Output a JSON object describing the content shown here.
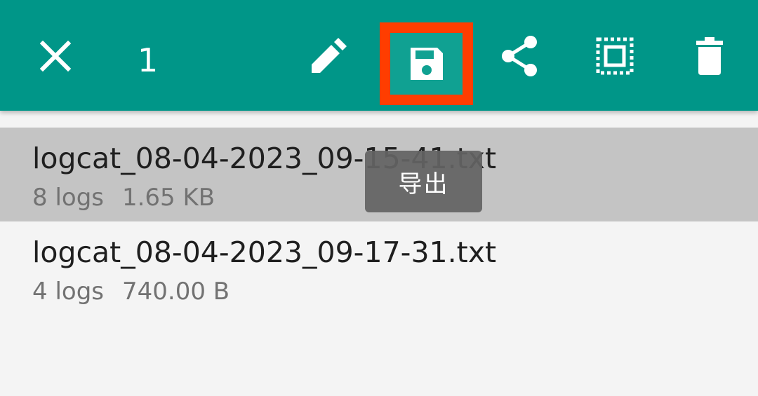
{
  "toolbar": {
    "selected_count": "1",
    "icons": [
      "close-icon",
      "pencil-icon",
      "save-icon",
      "share-icon",
      "select-all-icon",
      "delete-icon"
    ],
    "background": "#009688",
    "highlight_color": "#ff3d00"
  },
  "files": [
    {
      "name": "logcat_08-04-2023_09-15-41.txt",
      "logs": "8 logs",
      "size": "1.65 KB",
      "selected": true
    },
    {
      "name": "logcat_08-04-2023_09-17-31.txt",
      "logs": "4 logs",
      "size": "740.00 B",
      "selected": false
    }
  ],
  "toast": {
    "text": "导出"
  }
}
